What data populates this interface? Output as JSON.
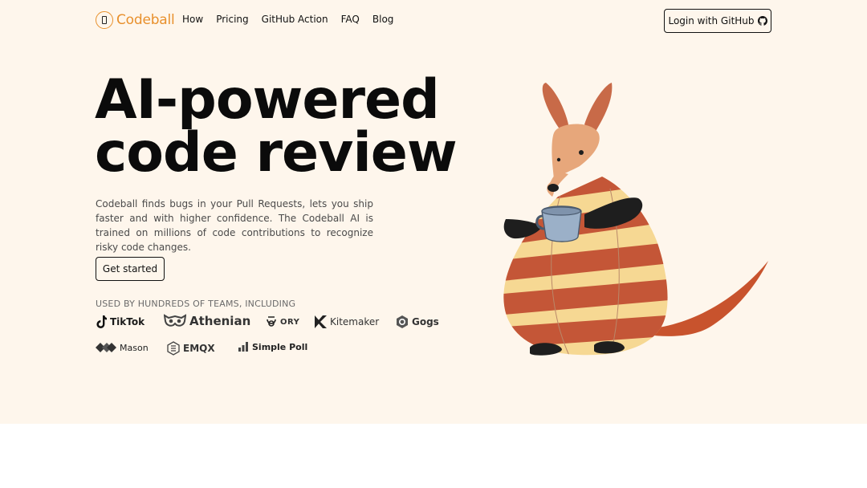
{
  "brand": {
    "name": "Codeball",
    "accent": "#e8902c"
  },
  "nav": {
    "links": [
      {
        "label": "How"
      },
      {
        "label": "Pricing"
      },
      {
        "label": "GitHub Action"
      },
      {
        "label": "FAQ"
      },
      {
        "label": "Blog"
      }
    ],
    "login_label": "Login with GitHub",
    "login_icon": "github-icon"
  },
  "hero": {
    "headline_line1": "AI-powered",
    "headline_line2": "code review",
    "description": "Codeball finds bugs in your Pull Requests, lets you ship faster and with higher confidence. The Codeball AI is trained on millions of code contributions to recognize risky code changes.",
    "cta_label": "Get started",
    "used_by_label": "USED BY HUNDREDS OF TEAMS, INCLUDING",
    "logos": [
      {
        "name": "TikTok"
      },
      {
        "name": "Athenian"
      },
      {
        "name": "ORY"
      },
      {
        "name": "Kitemaker"
      },
      {
        "name": "Gogs"
      },
      {
        "name": "Mason"
      },
      {
        "name": "EMQX"
      },
      {
        "name": "Simple Poll"
      }
    ]
  },
  "colors": {
    "hero_bg": "#fef6ec",
    "text": "#111111"
  }
}
